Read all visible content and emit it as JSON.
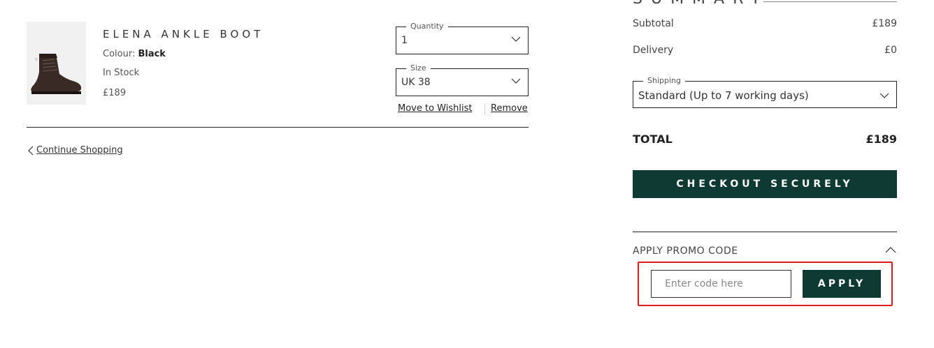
{
  "item": {
    "name": "ELENA ANKLE BOOT",
    "colour_label": "Colour: ",
    "colour_value": "Black",
    "stock": "In Stock",
    "price": "£189",
    "quantity": {
      "legend": "Quantity",
      "value": "1"
    },
    "size": {
      "legend": "Size",
      "value": "UK 38"
    },
    "move_to_wishlist": "Move to Wishlist",
    "remove": "Remove"
  },
  "continue_shopping": "Continue Shopping",
  "summary": {
    "heading": "SUMMARY",
    "subtotal_label": "Subtotal",
    "subtotal_value": "£189",
    "delivery_label": "Delivery",
    "delivery_value": "£0",
    "shipping": {
      "legend": "Shipping",
      "value": "Standard (Up to 7 working days)"
    },
    "total_label": "TOTAL",
    "total_value": "£189",
    "checkout_label": "CHECKOUT SECURELY"
  },
  "promo": {
    "heading": "APPLY PROMO CODE",
    "placeholder": "Enter code here",
    "apply_label": "APPLY"
  },
  "colors": {
    "brand_dark_green": "#0f3a34",
    "highlight_red": "#e11b1b"
  }
}
